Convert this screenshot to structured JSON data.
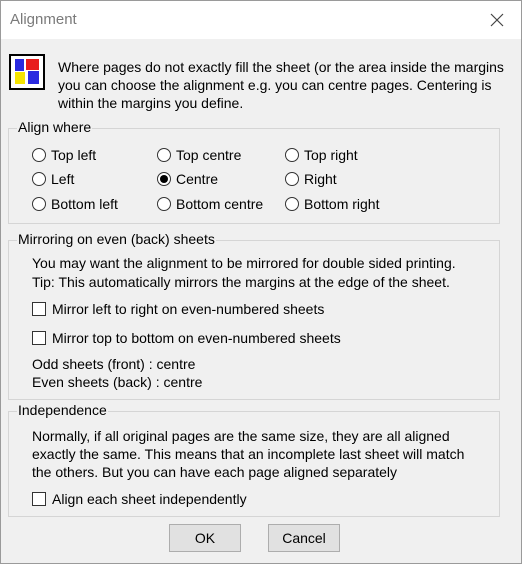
{
  "window": {
    "title": "Alignment"
  },
  "intro": "Where pages do not exactly fill the sheet (or the area inside the margins you can choose the alignment e.g. you can centre pages. Centering is within the margins you define.",
  "align_where": {
    "legend": "Align where",
    "options": [
      {
        "label": "Top left",
        "selected": false
      },
      {
        "label": "Top centre",
        "selected": false
      },
      {
        "label": "Top right",
        "selected": false
      },
      {
        "label": "Left",
        "selected": false
      },
      {
        "label": "Centre",
        "selected": true
      },
      {
        "label": "Right",
        "selected": false
      },
      {
        "label": "Bottom left",
        "selected": false
      },
      {
        "label": "Bottom centre",
        "selected": false
      },
      {
        "label": "Bottom right",
        "selected": false
      }
    ]
  },
  "mirroring": {
    "legend": "Mirroring on even (back) sheets",
    "line1": "You may want the alignment to be mirrored for double sided printing.",
    "line2": "Tip: This automatically mirrors the margins at the edge of the sheet.",
    "mirror_lr": {
      "label": "Mirror left to right on even-numbered sheets",
      "checked": false
    },
    "mirror_tb": {
      "label": "Mirror top to bottom on even-numbered sheets",
      "checked": false
    },
    "odd_status": "Odd sheets (front) : centre",
    "even_status": "Even sheets (back) : centre"
  },
  "independence": {
    "legend": "Independence",
    "line1": "Normally, if all original pages are the same size, they are all aligned",
    "line2": "exactly the same. This means that an incomplete last sheet will match",
    "line3": "the others. But you can have each page aligned separately",
    "align_each": {
      "label": "Align each sheet independently",
      "checked": false
    }
  },
  "buttons": {
    "ok": "OK",
    "cancel": "Cancel"
  },
  "colors": {
    "icon_red": "#e81c1c",
    "icon_blue": "#2a2ae0",
    "icon_yellow": "#f5e400"
  }
}
